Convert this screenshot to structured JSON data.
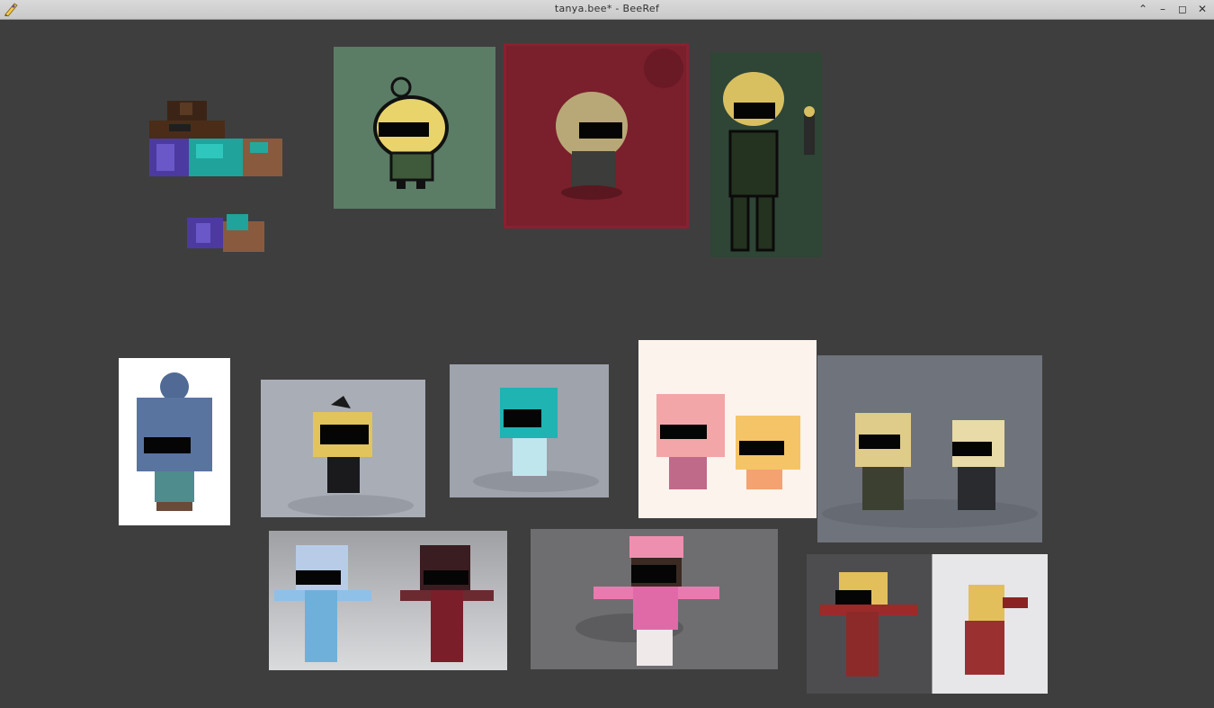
{
  "window": {
    "title": "tanya.bee* - BeeRef",
    "app_name": "BeeRef",
    "controls": {
      "shade": "⌃",
      "minimize": "–",
      "maximize": "◻",
      "close": "✕"
    }
  },
  "canvas": {
    "background": "#3e3e3e",
    "images": [
      {
        "name": "minecraft-skin-parts",
        "bg": "transparent"
      },
      {
        "name": "minecraft-skin-small",
        "bg": "transparent"
      },
      {
        "name": "pixel-chibi-green",
        "bg": "#5b7c65"
      },
      {
        "name": "pixel-chibi-red",
        "bg": "#7a1f2c"
      },
      {
        "name": "pixel-sprite-dark-green",
        "bg": "#2f4536"
      },
      {
        "name": "voxel-blue-hair-back",
        "bg": "#ffffff"
      },
      {
        "name": "voxel-blonde-bow",
        "bg": "#a9adb6"
      },
      {
        "name": "voxel-teal-hair",
        "bg": "#9ea3ac"
      },
      {
        "name": "voxel-pink-and-blonde-duo",
        "bg": "#fbf3ec"
      },
      {
        "name": "voxel-soldier-duo",
        "bg": "#6f737b"
      },
      {
        "name": "voxel-horned-tpose-duo",
        "bg": "#cfcfd1"
      },
      {
        "name": "voxel-pink-jacket-tpose",
        "bg": "#6e6e70"
      },
      {
        "name": "voxel-armored-blonde-pair",
        "bg": "#4d4d4f"
      }
    ]
  }
}
